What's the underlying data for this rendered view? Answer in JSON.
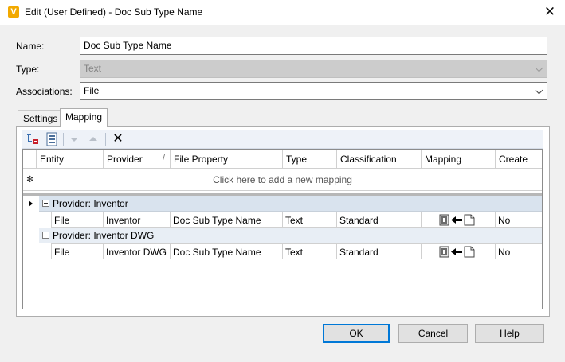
{
  "window": {
    "app_icon_letter": "V",
    "title": "Edit (User Defined) - Doc Sub Type Name",
    "close_glyph": "✕"
  },
  "form": {
    "name_label": "Name:",
    "name_value": "Doc Sub Type Name",
    "type_label": "Type:",
    "type_value": "Text",
    "associations_label": "Associations:",
    "associations_value": "File"
  },
  "tabs": [
    {
      "label": "Settings",
      "active": false
    },
    {
      "label": "Mapping",
      "active": true
    }
  ],
  "toolbar": {
    "icons": [
      "add-mapping-icon",
      "properties-icon",
      "move-down-icon",
      "move-up-icon",
      "delete-icon"
    ],
    "delete_glyph": "✕"
  },
  "grid": {
    "columns": [
      "Entity",
      "Provider",
      "File Property",
      "Type",
      "Classification",
      "Mapping",
      "Create"
    ],
    "sort_glyph": "/",
    "new_row_glyph": "✻",
    "new_row_hint": "Click here to add a new mapping",
    "groups": [
      {
        "label": "Provider: Inventor",
        "rows": [
          {
            "entity": "File",
            "provider": "Inventor",
            "file_property": "Doc Sub Type Name",
            "type": "Text",
            "classification": "Standard",
            "mapping": "read-from-file-icon",
            "create": "No"
          }
        ]
      },
      {
        "label": "Provider: Inventor DWG",
        "rows": [
          {
            "entity": "File",
            "provider": "Inventor DWG",
            "file_property": "Doc Sub Type Name",
            "type": "Text",
            "classification": "Standard",
            "mapping": "read-from-file-icon",
            "create": "No"
          }
        ]
      }
    ]
  },
  "buttons": {
    "ok": "OK",
    "cancel": "Cancel",
    "help": "Help"
  },
  "colors": {
    "accent": "#0078d7",
    "group_header": "#d9e3ee",
    "app_icon": "#f2a900"
  }
}
